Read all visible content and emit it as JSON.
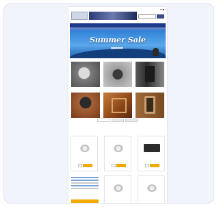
{
  "header": {
    "top_links": "",
    "logo_text": "",
    "search_placeholder": "",
    "icons": [
      "user-icon",
      "cart-icon"
    ]
  },
  "category_nav": {
    "items": [
      "",
      "",
      "",
      "",
      "",
      ""
    ]
  },
  "hero": {
    "title": "Summer Sale"
  },
  "categories": [
    {
      "label": ""
    },
    {
      "label": ""
    },
    {
      "label": ""
    },
    {
      "label": ""
    },
    {
      "label": ""
    },
    {
      "label": ""
    }
  ],
  "products_section": {
    "title": "",
    "tabs": [
      "",
      "",
      ""
    ]
  },
  "products": [
    {
      "name": "",
      "price": "",
      "stock": "",
      "buy_label": "",
      "img": "round"
    },
    {
      "name": "",
      "price": "",
      "stock": "",
      "buy_label": "",
      "img": "round"
    },
    {
      "name": "",
      "price": "",
      "stock": "",
      "buy_label": "",
      "img": "box"
    },
    {
      "name": "",
      "price": "",
      "stock": "",
      "buy_label": "",
      "img": "round"
    },
    {
      "name": "",
      "price": "",
      "stock": "",
      "buy_label": "",
      "img": "round"
    }
  ],
  "info_panel": {
    "chat_text": "",
    "button_label": ""
  },
  "colors": {
    "nav": "#1e3a8a",
    "buy": "#f2a900",
    "hero": "#2e7fd6"
  }
}
